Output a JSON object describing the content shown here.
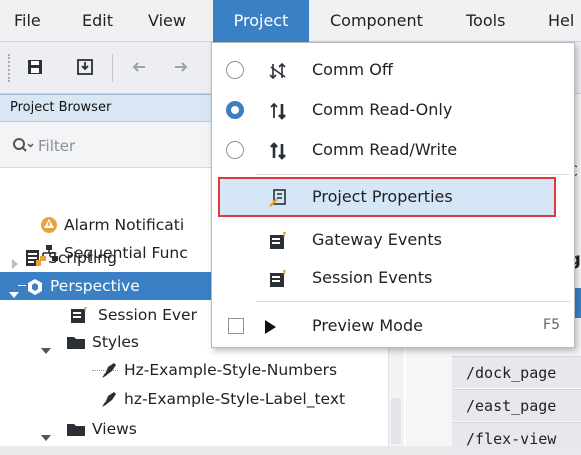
{
  "menubar": {
    "items": [
      "File",
      "Edit",
      "View",
      "Project",
      "Component",
      "Tools",
      "Hel"
    ]
  },
  "project_browser": {
    "title": "Project Browser",
    "filter_placeholder": "Filter",
    "tree": [
      "Alarm Notificati",
      "Sequential Func",
      "Scripting",
      "Perspective",
      "Session Ever",
      "Styles",
      "Hz-Example-Style-Numbers",
      "hz-Example-Style-Label_text",
      "Views"
    ]
  },
  "right_panel": {
    "partial_1": "e",
    "partial_2": "HC",
    "partial_3": "fig",
    "partial_4": "ng",
    "partial_5": "t/",
    "code_rows": [
      "/dock_page",
      "/east_page",
      "/flex-view"
    ]
  },
  "project_menu": {
    "comm_off": "Comm Off",
    "comm_read_only": "Comm Read-Only",
    "comm_read_write": "Comm Read/Write",
    "project_properties": "Project Properties",
    "gateway_events": "Gateway Events",
    "session_events": "Session Events",
    "preview_mode": "Preview Mode",
    "preview_shortcut": "F5"
  },
  "colors": {
    "accent": "#3b80c4",
    "highlight_outline": "#e4363b",
    "hover_row": "#d5e6f7"
  }
}
